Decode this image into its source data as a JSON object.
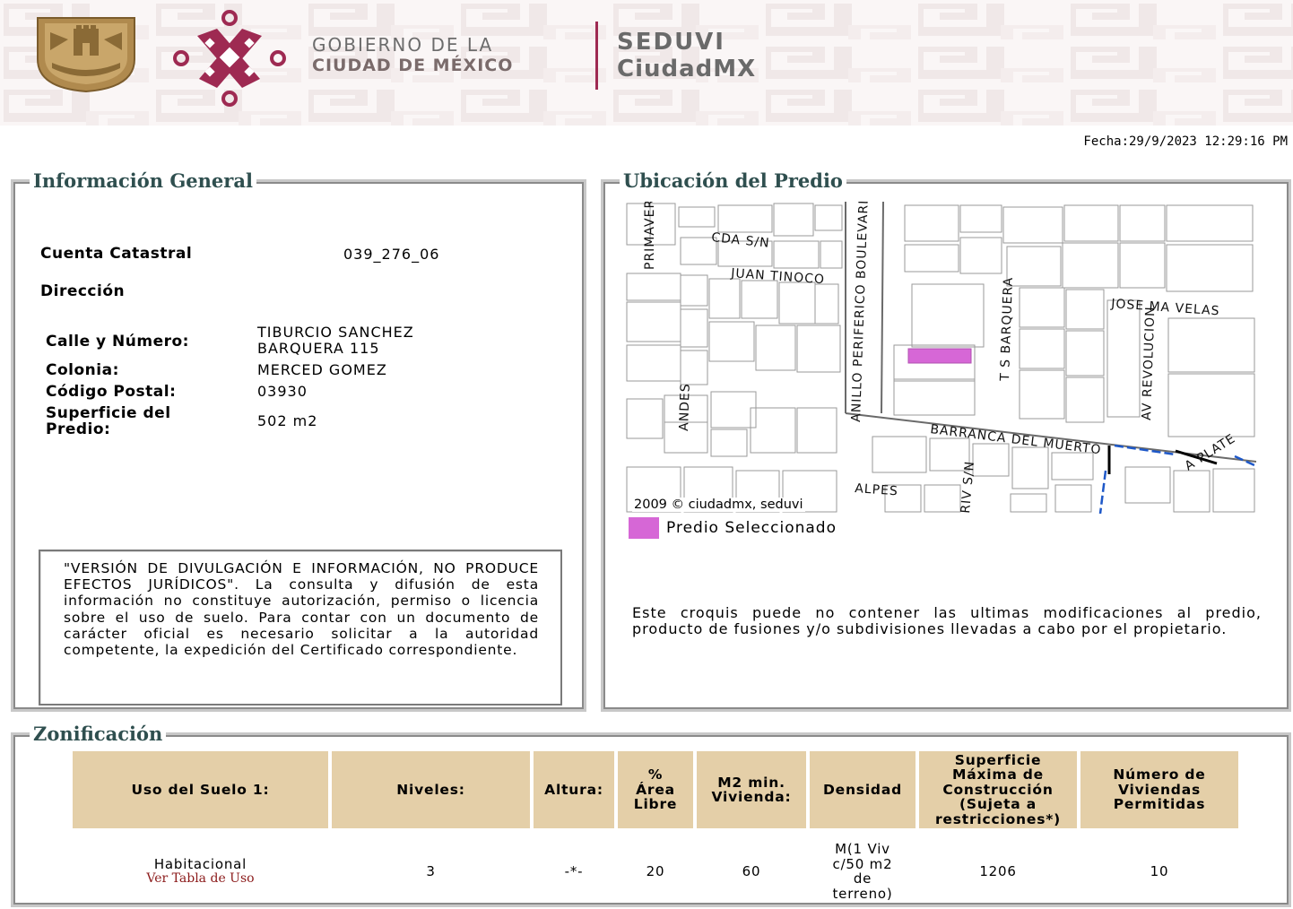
{
  "header": {
    "gov_line1": "GOBIERNO DE LA",
    "gov_line2": "CIUDAD DE MÉXICO",
    "seduvi": "SEDUVI",
    "ciudadmx": "CiudadMX"
  },
  "fecha": "Fecha:29/9/2023 12:29:16 PM",
  "info_general": {
    "legend": "Información General",
    "cuenta_label": "Cuenta Catastral",
    "cuenta_value": "039_276_06",
    "direccion_label": "Dirección",
    "calle_label": "Calle y Número:",
    "calle_value_1": "TIBURCIO SANCHEZ",
    "calle_value_2": "BARQUERA 115",
    "colonia_label": "Colonia:",
    "colonia_value": "MERCED GOMEZ",
    "cp_label": "Código Postal:",
    "cp_value": "03930",
    "superficie_label_1": "Superficie del",
    "superficie_label_2": "Predio:",
    "superficie_value": "502 m2",
    "disclaimer": "\"VERSIÓN DE DIVULGACIÓN E INFORMACIÓN, NO PRODUCE EFECTOS JURÍDICOS\". La consulta y difusión de esta información no constituye autorización, permiso o licencia sobre el uso de suelo. Para contar con un documento de carácter oficial es necesario solicitar a la autoridad competente, la expedición del Certificado correspondiente."
  },
  "ubicacion": {
    "legend": "Ubicación del Predio",
    "map_credit": "2009 © ciudadmx, seduvi",
    "streets": {
      "primaver": "PRIMAVER",
      "cda": "CDA S/N",
      "juan_tinoco": "JUAN TINOCO",
      "periferico": "ANILLO PERIFERICO BOULEVARD A",
      "barquera": "T S BARQUERA",
      "jose_ma": "JOSE MA VELAS",
      "revolucion": "AV REVOLUCION",
      "andes": "ANDES",
      "barranca": "BARRANCA DEL MUERTO",
      "plate": "A PLATE",
      "alpes": "ALPES",
      "riv": "RIV S/N"
    },
    "legend_item": "Predio Seleccionado",
    "swatch_color": "#d667d6",
    "note": "Este croquis puede no contener las ultimas modificaciones al predio, producto de fusiones y/o subdivisiones llevadas a cabo por el propietario."
  },
  "zonificacion": {
    "legend": "Zonificación",
    "headers": {
      "uso": "Uso del Suelo 1:",
      "niveles": "Niveles:",
      "altura": "Altura:",
      "area_1": "%",
      "area_2": "Área",
      "area_3": "Libre",
      "m2_1": "M2 min.",
      "m2_2": "Vivienda:",
      "densidad": "Densidad",
      "sup_1": "Superficie",
      "sup_2": "Máxima de",
      "sup_3": "Construcción",
      "sup_4": "(Sujeta a",
      "sup_5": "restricciones*)",
      "num_1": "Número de",
      "num_2": "Viviendas",
      "num_3": "Permitidas"
    },
    "row": {
      "uso": "Habitacional",
      "ver_tabla": "Ver Tabla de Uso",
      "niveles": "3",
      "altura": "-*-",
      "area_libre": "20",
      "m2_min": "60",
      "densidad_1": "M(1 Viv",
      "densidad_2": "c/50 m2",
      "densidad_3": "de",
      "densidad_4": "terreno)",
      "superficie": "1206",
      "viviendas": "10"
    },
    "header_color": "#e4cfa8"
  }
}
